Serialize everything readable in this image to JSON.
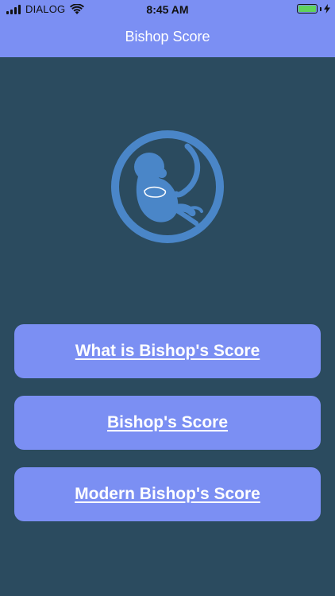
{
  "status_bar": {
    "carrier": "DIALOG",
    "time": "8:45 AM",
    "battery_color": "#5fd35b"
  },
  "header": {
    "title": "Bishop Score",
    "background": "#7b8ff3"
  },
  "logo": {
    "icon": "fetus-icon",
    "color": "#4a86c8"
  },
  "menu": {
    "items": [
      {
        "label": "What is Bishop's Score"
      },
      {
        "label": "Bishop's Score"
      },
      {
        "label": "Modern Bishop's Score"
      }
    ]
  },
  "colors": {
    "background": "#2b4b5f",
    "button": "#7b8ff3",
    "button_text": "#ffffff"
  }
}
